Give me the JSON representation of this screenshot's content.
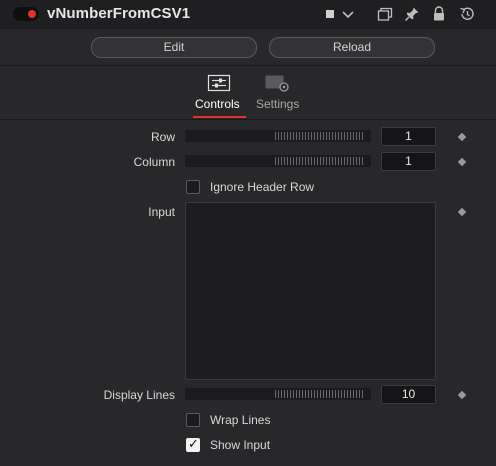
{
  "header": {
    "title": "vNumberFromCSV1"
  },
  "buttons": {
    "edit": "Edit",
    "reload": "Reload"
  },
  "tabs": [
    {
      "label": "Controls",
      "active": true
    },
    {
      "label": "Settings",
      "active": false
    }
  ],
  "controls": {
    "row": {
      "label": "Row",
      "value": "1"
    },
    "column": {
      "label": "Column",
      "value": "1"
    },
    "ignore_header": {
      "label": "Ignore Header Row",
      "checked": false
    },
    "input": {
      "label": "Input",
      "value": ""
    },
    "display_lines": {
      "label": "Display Lines",
      "value": "10"
    },
    "wrap_lines": {
      "label": "Wrap Lines",
      "checked": false
    },
    "show_input": {
      "label": "Show Input",
      "checked": true
    }
  },
  "colors": {
    "accent": "#e0332f",
    "background": "#28282a"
  }
}
